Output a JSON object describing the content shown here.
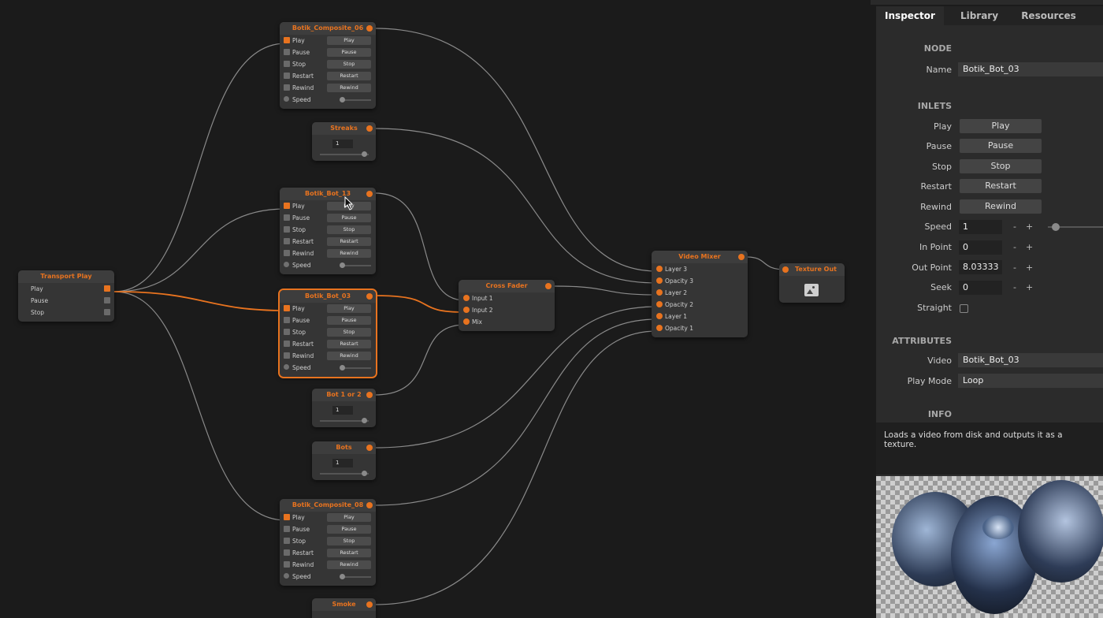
{
  "colors": {
    "accent": "#e8731f",
    "background": "#1b1b1b",
    "node": "#353535",
    "panel": "#2b2b2b"
  },
  "nodes": {
    "composite06": {
      "title": "Botik_Composite_06",
      "rows": [
        {
          "label": "Play",
          "button": "Play"
        },
        {
          "label": "Pause",
          "button": "Pause"
        },
        {
          "label": "Stop",
          "button": "Stop"
        },
        {
          "label": "Restart",
          "button": "Restart"
        },
        {
          "label": "Rewind",
          "button": "Rewind"
        },
        {
          "label": "Speed"
        }
      ]
    },
    "streaks": {
      "title": "Streaks",
      "value": "1"
    },
    "bot13": {
      "title": "Botik_Bot_13",
      "rows": [
        {
          "label": "Play",
          "button": "Play"
        },
        {
          "label": "Pause",
          "button": "Pause"
        },
        {
          "label": "Stop",
          "button": "Stop"
        },
        {
          "label": "Restart",
          "button": "Restart"
        },
        {
          "label": "Rewind",
          "button": "Rewind"
        },
        {
          "label": "Speed"
        }
      ]
    },
    "bot03": {
      "title": "Botik_Bot_03",
      "rows": [
        {
          "label": "Play",
          "button": "Play"
        },
        {
          "label": "Pause",
          "button": "Pause"
        },
        {
          "label": "Stop",
          "button": "Stop"
        },
        {
          "label": "Restart",
          "button": "Restart"
        },
        {
          "label": "Rewind",
          "button": "Rewind"
        },
        {
          "label": "Speed"
        }
      ]
    },
    "bot1or2": {
      "title": "Bot 1 or 2",
      "value": "1"
    },
    "bots": {
      "title": "Bots",
      "value": "1"
    },
    "composite08": {
      "title": "Botik_Composite_08",
      "rows": [
        {
          "label": "Play",
          "button": "Play"
        },
        {
          "label": "Pause",
          "button": "Pause"
        },
        {
          "label": "Stop",
          "button": "Stop"
        },
        {
          "label": "Restart",
          "button": "Restart"
        },
        {
          "label": "Rewind",
          "button": "Rewind"
        },
        {
          "label": "Speed"
        }
      ]
    },
    "smoke": {
      "title": "Smoke"
    },
    "transport": {
      "title": "Transport Play",
      "outputs": [
        "Play",
        "Pause",
        "Stop"
      ]
    },
    "crossfader": {
      "title": "Cross Fader",
      "inputs": [
        "Input 1",
        "Input 2",
        "Mix"
      ]
    },
    "videomixer": {
      "title": "Video Mixer",
      "inputs": [
        "Layer 3",
        "Opacity 3",
        "Layer 2",
        "Opacity 2",
        "Layer 1",
        "Opacity 1"
      ]
    },
    "textureout": {
      "title": "Texture Out",
      "icon": "image-icon"
    }
  },
  "inspector": {
    "tabs": [
      "Inspector",
      "Library",
      "Resources"
    ],
    "node_section": "NODE",
    "name_label": "Name",
    "name_value": "Botik_Bot_03",
    "inlets_section": "INLETS",
    "inlets": [
      {
        "label": "Play",
        "button": "Play"
      },
      {
        "label": "Pause",
        "button": "Pause"
      },
      {
        "label": "Stop",
        "button": "Stop"
      },
      {
        "label": "Restart",
        "button": "Restart"
      },
      {
        "label": "Rewind",
        "button": "Rewind"
      }
    ],
    "speed": {
      "label": "Speed",
      "value": "1"
    },
    "in_point": {
      "label": "In Point",
      "value": "0"
    },
    "out_point": {
      "label": "Out Point",
      "value": "8.03333"
    },
    "seek": {
      "label": "Seek",
      "value": "0"
    },
    "straight_label": "Straight",
    "minus": "-",
    "plus": "+",
    "attributes_section": "ATTRIBUTES",
    "video": {
      "label": "Video",
      "value": "Botik_Bot_03"
    },
    "play_mode": {
      "label": "Play Mode",
      "value": "Loop"
    },
    "info_section": "INFO",
    "info_text": "Loads a video from disk and outputs it as a texture."
  }
}
